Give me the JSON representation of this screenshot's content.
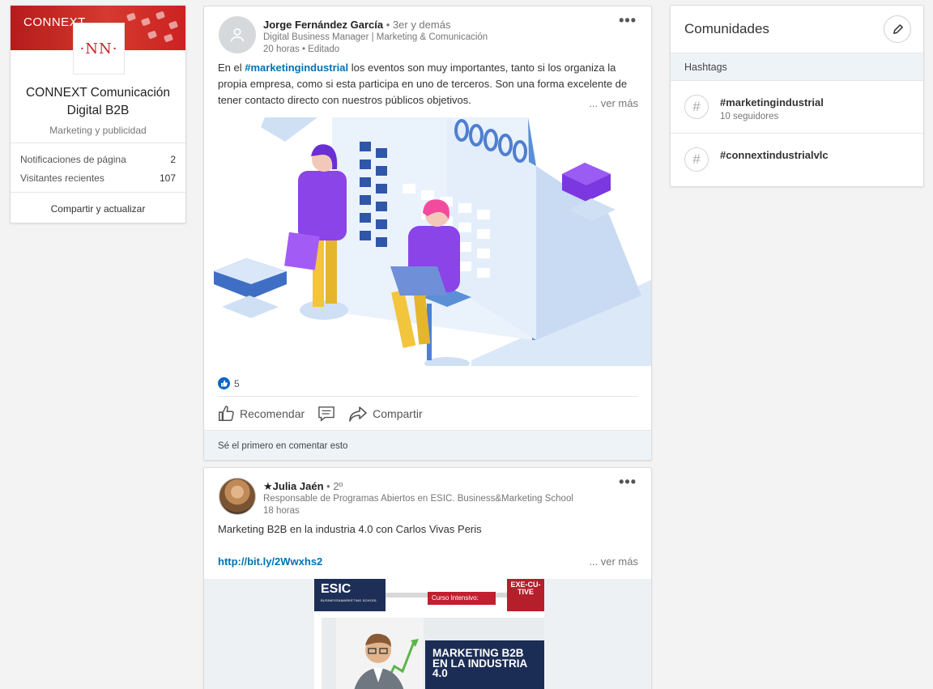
{
  "company": {
    "banner_brand": "CONNEXT",
    "logo_text": "·NN·",
    "name": "CONNEXT Comunicación Digital B2B",
    "industry": "Marketing y publicidad",
    "stats": [
      {
        "label": "Notificaciones de página",
        "value": "2"
      },
      {
        "label": "Visitantes recientes",
        "value": "107"
      }
    ],
    "share_label": "Compartir y actualizar"
  },
  "post1": {
    "author": "Jorge Fernández García",
    "degree": "• 3er y demás",
    "headline": "Digital Business Manager | Marketing & Comunicación",
    "time": "20 horas • Editado",
    "text_before": "En el ",
    "hashtag": "#marketingindustrial",
    "text_after": " los eventos son muy importantes, tanto si los organiza la propia empresa, como si esta participa en uno de terceros. Son una forma excelente de tener contacto directo con nuestros públicos objetivos.",
    "see_more": "... ver más",
    "reaction_count": "5",
    "actions": {
      "like": "Recomendar",
      "share": "Compartir"
    },
    "comments_prompt": "Sé el primero en comentar esto"
  },
  "post2": {
    "author": "★Julia Jaén",
    "degree": "• 2º",
    "headline": "Responsable de Programas Abiertos en ESIC. Business&Marketing School",
    "time": "18 horas",
    "text": "Marketing B2B en la industria 4.0 con Carlos Vivas Peris",
    "link": "http://bit.ly/2Wwxhs2",
    "see_more": "... ver más",
    "media": {
      "logo": "ESIC",
      "logo_sub": "BUSINESS&MARKETING SCHOOL",
      "exec_badge": "EXE-CU-TIVE",
      "course_label": "Curso Intensivo:",
      "course_title": "MARKETING B2B EN LA INDUSTRIA 4.0"
    }
  },
  "communities": {
    "title": "Comunidades",
    "section": "Hashtags",
    "items": [
      {
        "tag": "#marketingindustrial",
        "followers": "10 seguidores"
      },
      {
        "tag": "#connextindustrialvlc",
        "followers": ""
      }
    ]
  }
}
